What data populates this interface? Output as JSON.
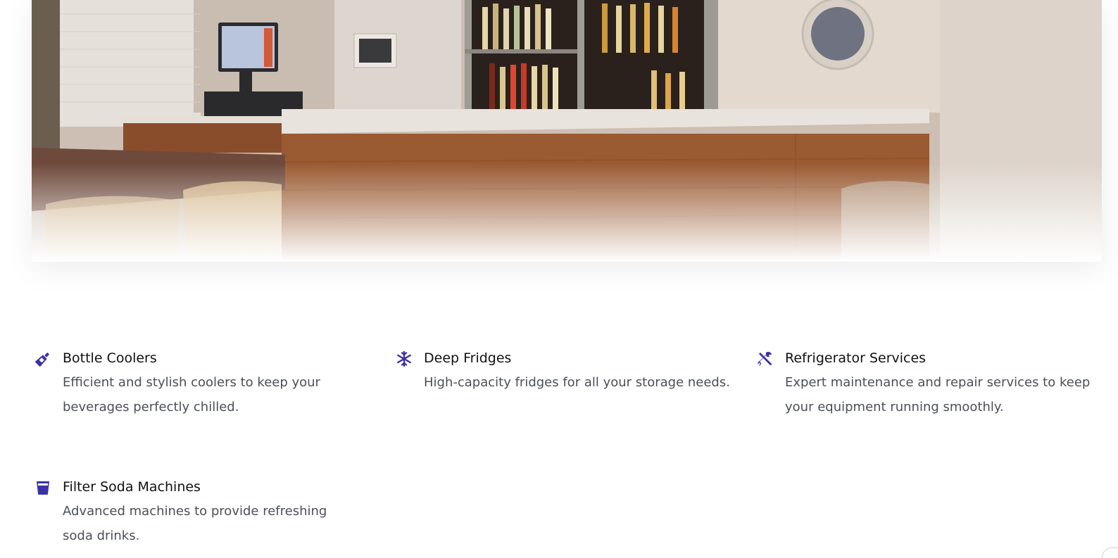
{
  "hero": {
    "image_subject": "bar-counter-photo"
  },
  "features": [
    {
      "icon": "bottle-icon",
      "title": "Bottle Coolers",
      "description": "Efficient and stylish coolers to keep your beverages perfectly chilled."
    },
    {
      "icon": "snowflake-icon",
      "title": "Deep Fridges",
      "description": "High-capacity fridges for all your storage needs."
    },
    {
      "icon": "tools-icon",
      "title": "Refrigerator Services",
      "description": "Expert maintenance and repair services to keep your equipment running smoothly."
    },
    {
      "icon": "glass-icon",
      "title": "Filter Soda Machines",
      "description": "Advanced machines to provide refreshing soda drinks."
    }
  ],
  "colors": {
    "icon_accent": "#3b32a8",
    "title_text": "#111111",
    "description_text": "#4a4f5a"
  }
}
